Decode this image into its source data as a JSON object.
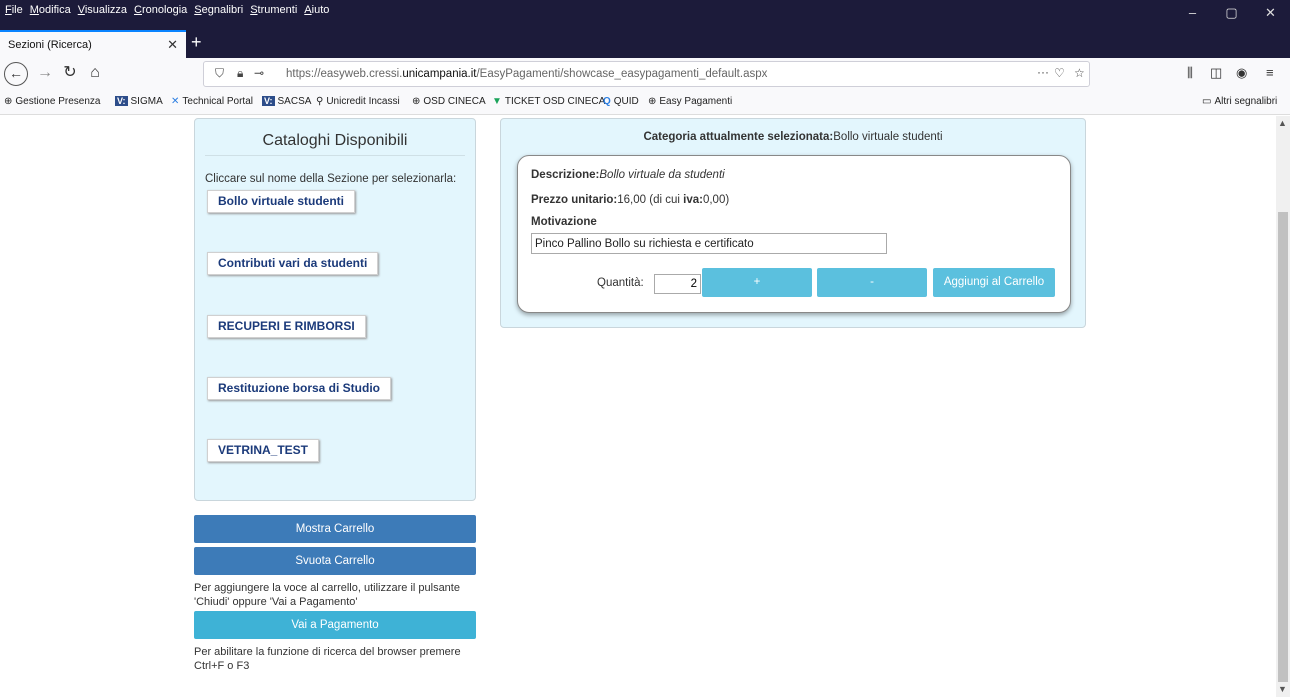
{
  "browser": {
    "menu": [
      "File",
      "Modifica",
      "Visualizza",
      "Cronologia",
      "Segnalibri",
      "Strumenti",
      "Aiuto"
    ],
    "window_controls": [
      "–",
      "▢",
      "✕"
    ],
    "tab_title": "Sezioni (Ricerca)",
    "tab_close": "✕",
    "new_tab": "+",
    "url_prefix": "https://easyweb.cressi.",
    "url_domain": "unicampania.it",
    "url_rest": "/EasyPagamenti/showcase_easypagamenti_default.aspx",
    "bookmarks": [
      {
        "icon": "globe-icon",
        "glyph": "⊕",
        "label": "Gestione Presenza"
      },
      {
        "icon": "v-badge-icon",
        "glyph": "V:",
        "label": "SIGMA"
      },
      {
        "icon": "technical-portal-icon",
        "glyph": "✕",
        "label": "Technical Portal"
      },
      {
        "icon": "v-badge-icon",
        "glyph": "V:",
        "label": "SACSA"
      },
      {
        "icon": "pin-icon",
        "glyph": "⚲",
        "label": "Unicredit Incassi"
      },
      {
        "icon": "globe-icon",
        "glyph": "⊕",
        "label": "OSD CINECA"
      },
      {
        "icon": "ticket-icon",
        "glyph": "▼",
        "label": "TICKET OSD CINECA"
      },
      {
        "icon": "quid-icon",
        "glyph": "Q",
        "label": "QUID"
      },
      {
        "icon": "globe-icon",
        "glyph": "⊕",
        "label": "Easy Pagamenti"
      }
    ],
    "other_bookmarks": "Altri segnalibri"
  },
  "catalog": {
    "title": "Cataloghi Disponibili",
    "hint": "Cliccare sul nome della Sezione per selezionarla:",
    "items": [
      "Bollo virtuale studenti",
      "Contributi vari da studenti",
      "RECUPERI E RIMBORSI",
      "Restituzione borsa di Studio",
      "VETRINA_TEST"
    ]
  },
  "cart": {
    "show_label": "Mostra Carrello",
    "empty_label": "Svuota Carrello",
    "note1": "Per aggiungere la voce al carrello, utilizzare il pulsante 'Chiudi' oppure 'Vai a Pagamento'",
    "pay_label": "Vai a Pagamento",
    "note2": "Per abilitare la funzione di ricerca del browser premere Ctrl+F o F3"
  },
  "selection": {
    "header_label": "Categoria attualmente selezionata:",
    "header_value": "Bollo virtuale studenti",
    "desc_label": "Descrizione:",
    "desc_value": "Bollo virtuale da studenti",
    "price_label": "Prezzo unitario:",
    "price_value": "16,00",
    "price_mid": " (di cui ",
    "iva_label": "iva:",
    "iva_value": "0,00)",
    "motivation_label": "Motivazione",
    "motivation_value": "Pinco Pallino Bollo su richiesta e certificato",
    "qty_label": "Quantità:",
    "qty_value": "2",
    "plus_label": "+",
    "minus_label": "-",
    "add_label": "Aggiungi al Carrello"
  }
}
